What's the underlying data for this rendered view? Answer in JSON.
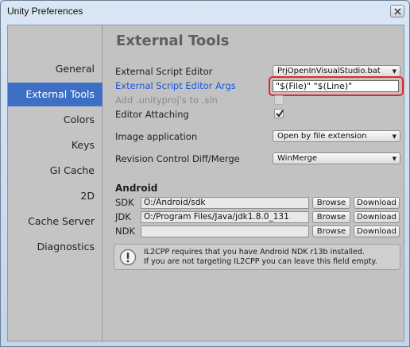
{
  "window": {
    "title": "Unity Preferences"
  },
  "sidebar": {
    "items": [
      {
        "label": "General"
      },
      {
        "label": "External Tools"
      },
      {
        "label": "Colors"
      },
      {
        "label": "Keys"
      },
      {
        "label": "GI Cache"
      },
      {
        "label": "2D"
      },
      {
        "label": "Cache Server"
      },
      {
        "label": "Diagnostics"
      }
    ],
    "active": "External Tools"
  },
  "main": {
    "title": "External Tools",
    "script_editor": {
      "label": "External Script Editor",
      "value": "PrjOpenInVisualStudio.bat"
    },
    "script_args": {
      "label": "External Script Editor Args",
      "value": "\"$(File)\" \"$(Line)\""
    },
    "add_unityproj": {
      "label": "Add .unityproj's to .sln",
      "checked": false
    },
    "editor_attaching": {
      "label": "Editor Attaching",
      "checked": true
    },
    "image_app": {
      "label": "Image application",
      "value": "Open by file extension"
    },
    "revision_control": {
      "label": "Revision Control Diff/Merge",
      "value": "WinMerge"
    },
    "android": {
      "section_label": "Android",
      "rows": [
        {
          "label": "SDK",
          "path": "O:/Android/sdk",
          "browse": "Browse",
          "download": "Download"
        },
        {
          "label": "JDK",
          "path": "O:/Program Files/Java/jdk1.8.0_131",
          "browse": "Browse",
          "download": "Download"
        },
        {
          "label": "NDK",
          "path": "",
          "browse": "Browse",
          "download": "Download"
        }
      ]
    },
    "help": {
      "line1": "IL2CPP requires that you have Android NDK r13b installed.",
      "line2": "If you are not targeting IL2CPP you can leave this field empty."
    }
  },
  "colors": {
    "accent": "#3d6fc4",
    "highlight_label": "#1a55d8",
    "annotation": "#e02a2a"
  }
}
